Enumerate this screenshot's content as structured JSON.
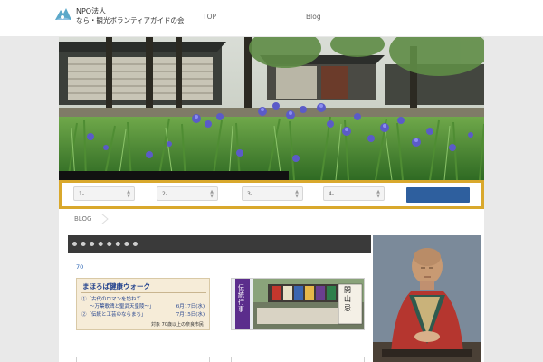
{
  "header": {
    "logo_icon": "mountain-logo-icon",
    "org_line1": "NPO法人",
    "org_line2": "なら・観光ボランティアガイドの会",
    "nav": [
      {
        "label": "TOP"
      },
      {
        "label": "Blog"
      }
    ]
  },
  "search": {
    "selects": [
      "1-",
      "2-",
      "3-",
      "4-"
    ],
    "accent_color": "#d9a82c",
    "button_color": "#2e5f9e"
  },
  "breadcrumb": {
    "label": "BLOG"
  },
  "section": {
    "count": "70"
  },
  "card1": {
    "title": "まほろば健康ウォーク",
    "line1_left": "①「古代のロマンを訪ねて",
    "line1_sub": "〜万葉歌碑と聖武天皇陵〜」",
    "line1_date": "6月17日(水)",
    "line2_left": "②「伝統と工芸のならまち」",
    "line2_date": "7月15日(水)",
    "footer": "対象 70歳以上の奈良市民"
  },
  "card2": {
    "banner_vertical": "伝統行事",
    "sign_text": "開山忌"
  }
}
